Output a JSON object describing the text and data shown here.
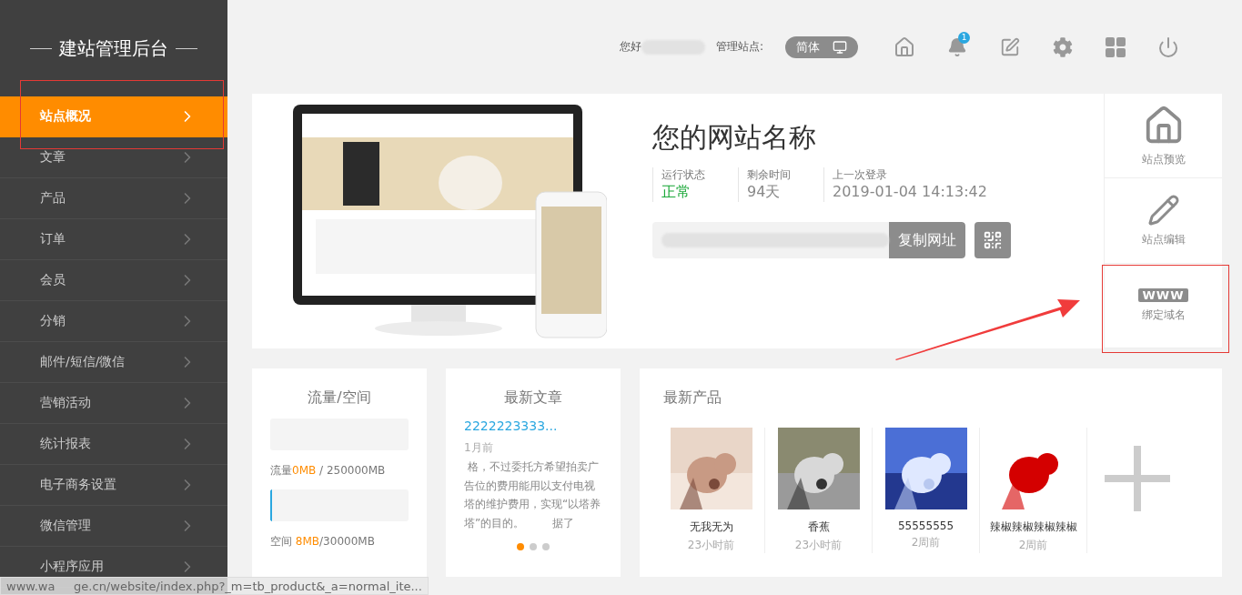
{
  "sidebar": {
    "title": "建站管理后台",
    "items": [
      {
        "label": "站点概况",
        "selected": true
      },
      {
        "label": "文章",
        "selected": false
      },
      {
        "label": "产品",
        "selected": false
      },
      {
        "label": "订单",
        "selected": false
      },
      {
        "label": "会员",
        "selected": false
      },
      {
        "label": "分销",
        "selected": false
      },
      {
        "label": "邮件/短信/微信",
        "selected": false
      },
      {
        "label": "营销活动",
        "selected": false
      },
      {
        "label": "统计报表",
        "selected": false
      },
      {
        "label": "电子商务设置",
        "selected": false
      },
      {
        "label": "微信管理",
        "selected": false
      },
      {
        "label": "小程序应用",
        "selected": false
      }
    ]
  },
  "topbar": {
    "greeting": "您好",
    "site_label": "管理站点:",
    "language": "简体",
    "notification_count": "1"
  },
  "site": {
    "name": "您的网站名称",
    "stats": [
      {
        "label": "运行状态",
        "value": "正常",
        "kind": "ok"
      },
      {
        "label": "剩余时间",
        "value": "94天",
        "kind": "plain"
      },
      {
        "label": "上一次登录",
        "value": "2019-01-04 14:13:42",
        "kind": "plain"
      }
    ],
    "copy_button": "复制网址",
    "actions": [
      {
        "label": "站点预览",
        "kind": "preview"
      },
      {
        "label": "站点编辑",
        "kind": "edit"
      },
      {
        "label": "绑定域名",
        "kind": "domain",
        "badge": "WWW"
      }
    ]
  },
  "usage": {
    "title": "流量/空间",
    "meters": [
      {
        "parts": [
          {
            "text": "流量",
            "accent": false
          },
          {
            "text": "0MB",
            "accent": true
          },
          {
            "text": " / 250000MB",
            "accent": false
          }
        ]
      },
      {
        "level": 0.004,
        "parts": [
          {
            "text": "空间 ",
            "accent": false
          },
          {
            "text": "8MB",
            "accent": true
          },
          {
            "text": "/30000MB",
            "accent": false
          }
        ]
      }
    ]
  },
  "articles": {
    "title": "最新文章",
    "link": "2222223333...",
    "time": "1月前",
    "excerpt": " 格，不过委托方希望拍卖广告位的费用能用以支付电视塔的维护费用，实现“以塔养塔”的目的。        据了",
    "dots": [
      {
        "selected": true
      },
      {
        "selected": false
      },
      {
        "selected": false
      }
    ]
  },
  "products": {
    "title": "最新产品",
    "items": [
      {
        "name": "无我无为",
        "time": "23小时前"
      },
      {
        "name": "香蕉",
        "time": "23小时前"
      },
      {
        "name": "55555555",
        "time": "2周前"
      },
      {
        "name": "辣椒辣椒辣椒辣椒",
        "time": "2周前"
      }
    ]
  },
  "status_bar": {
    "url": "www.wa     ge.cn/website/index.php?_m=tb_product&_a=normal_ite..."
  }
}
